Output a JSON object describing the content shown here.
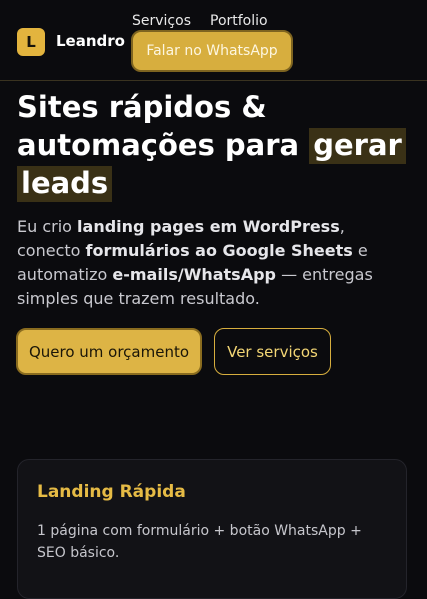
{
  "header": {
    "logo_letter": "L",
    "brand": "Leandro",
    "nav": [
      "Serviços",
      "Portfolio"
    ],
    "whatsapp_button": "Falar no WhatsApp"
  },
  "hero": {
    "title_line1": "Sites rápidos &",
    "title_line2_a": "automações para",
    "title_highlight_1": "gerar",
    "title_highlight_2": "leads",
    "text": {
      "p1": "Eu crio ",
      "b1": "landing pages em WordPress",
      "p2": ", conecto ",
      "b2": "formulários ao Google Sheets",
      "p3": " e automatizo ",
      "b3": "e-mails/WhatsApp",
      "p4": " — entregas simples que trazem resultado."
    },
    "primary_cta": "Quero um orçamento",
    "secondary_cta": "Ver serviços"
  },
  "card": {
    "title": "Landing Rápida",
    "description": "1 página com formulário + botão WhatsApp + SEO básico."
  },
  "colors": {
    "background": "#0b0b0e",
    "accent": "#e3b43e",
    "highlight_bg": "#3a3116"
  }
}
